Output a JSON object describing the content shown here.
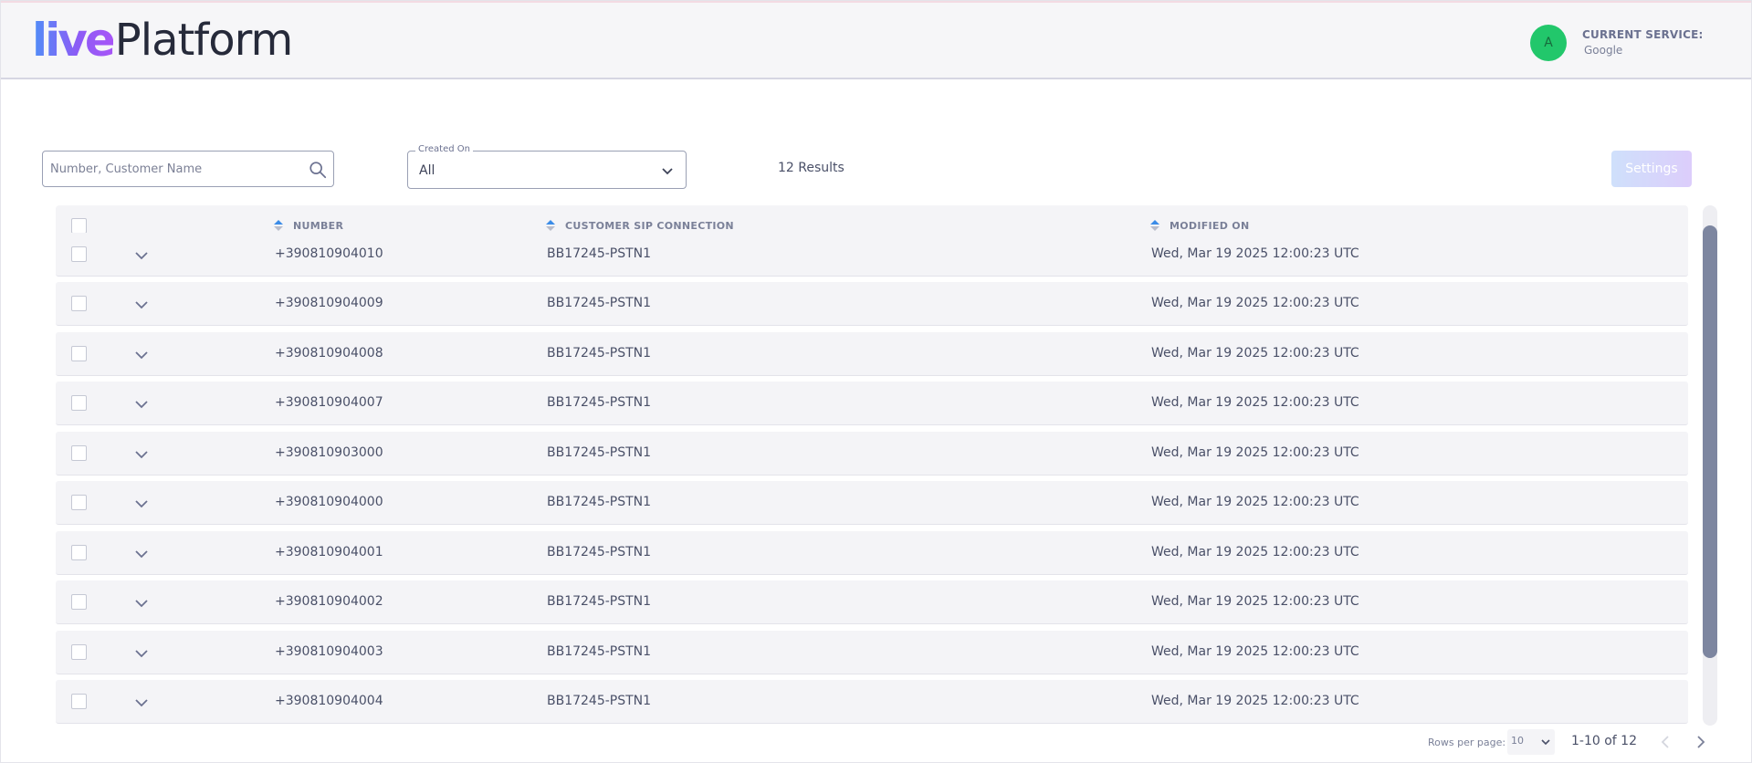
{
  "header": {
    "logo_part1": "live",
    "logo_part2": "Platform",
    "avatar_initial": "A",
    "service_label": "CURRENT SERVICE:",
    "service_value": "Google"
  },
  "filters": {
    "search_placeholder": "Number, Customer Name",
    "search_value": "",
    "created_on_label": "Created On",
    "created_on_value": "All",
    "results_text": "12 Results",
    "settings_label": "Settings"
  },
  "table": {
    "columns": [
      "NUMBER",
      "CUSTOMER SIP CONNECTION",
      "MODIFIED ON"
    ],
    "rows": [
      {
        "number": "+390810904010",
        "sip": "BB17245-PSTN1",
        "modified": "Wed, Mar 19 2025 12:00:23 UTC"
      },
      {
        "number": "+390810904009",
        "sip": "BB17245-PSTN1",
        "modified": "Wed, Mar 19 2025 12:00:23 UTC"
      },
      {
        "number": "+390810904008",
        "sip": "BB17245-PSTN1",
        "modified": "Wed, Mar 19 2025 12:00:23 UTC"
      },
      {
        "number": "+390810904007",
        "sip": "BB17245-PSTN1",
        "modified": "Wed, Mar 19 2025 12:00:23 UTC"
      },
      {
        "number": "+390810903000",
        "sip": "BB17245-PSTN1",
        "modified": "Wed, Mar 19 2025 12:00:23 UTC"
      },
      {
        "number": "+390810904000",
        "sip": "BB17245-PSTN1",
        "modified": "Wed, Mar 19 2025 12:00:23 UTC"
      },
      {
        "number": "+390810904001",
        "sip": "BB17245-PSTN1",
        "modified": "Wed, Mar 19 2025 12:00:23 UTC"
      },
      {
        "number": "+390810904002",
        "sip": "BB17245-PSTN1",
        "modified": "Wed, Mar 19 2025 12:00:23 UTC"
      },
      {
        "number": "+390810904003",
        "sip": "BB17245-PSTN1",
        "modified": "Wed, Mar 19 2025 12:00:23 UTC"
      },
      {
        "number": "+390810904004",
        "sip": "BB17245-PSTN1",
        "modified": "Wed, Mar 19 2025 12:00:23 UTC"
      }
    ]
  },
  "pagination": {
    "rows_per_page_label": "Rows per page:",
    "rows_per_page_value": "10",
    "range_text": "1-10 of 12"
  },
  "icons": {
    "search": "search-icon",
    "chevron": "chevron-down-icon",
    "sort": "sort-icon",
    "prev": "chevron-left-icon",
    "next": "chevron-right-icon"
  },
  "colors": {
    "avatar": "#22c76b",
    "scroll_thumb": "#7d86a0",
    "settings_gradient_start": "#cfe0fb",
    "settings_gradient_end": "#dccdfb",
    "sort_up": "#3b8ce8"
  }
}
